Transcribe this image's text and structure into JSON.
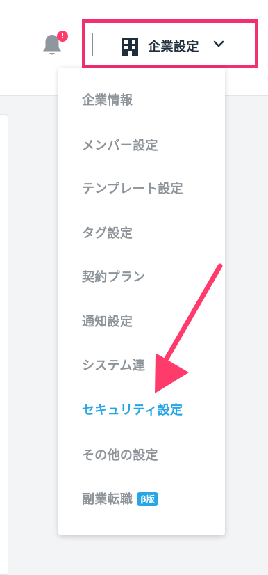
{
  "header": {
    "notification": {
      "icon": "bell-icon",
      "badge": "!"
    },
    "company_menu": {
      "icon": "building-icon",
      "label": "企業設定",
      "chevron": "chevron-down-icon"
    }
  },
  "menu": {
    "items": [
      {
        "label": "企業情報"
      },
      {
        "label": "メンバー設定"
      },
      {
        "label": "テンプレート設定"
      },
      {
        "label": "タグ設定"
      },
      {
        "label": "契約プラン"
      },
      {
        "label": "通知設定"
      },
      {
        "label": "システム連"
      },
      {
        "label": "セキュリティ設定",
        "active": true
      },
      {
        "label": "その他の設定"
      },
      {
        "label": "副業転職",
        "badge": "β版"
      }
    ]
  },
  "colors": {
    "highlight": "#f0306f",
    "annotation_arrow": "#ff3b6b",
    "active": "#27a6e5",
    "muted_text": "#8c9399",
    "notification_badge": "#ff3b6b"
  }
}
